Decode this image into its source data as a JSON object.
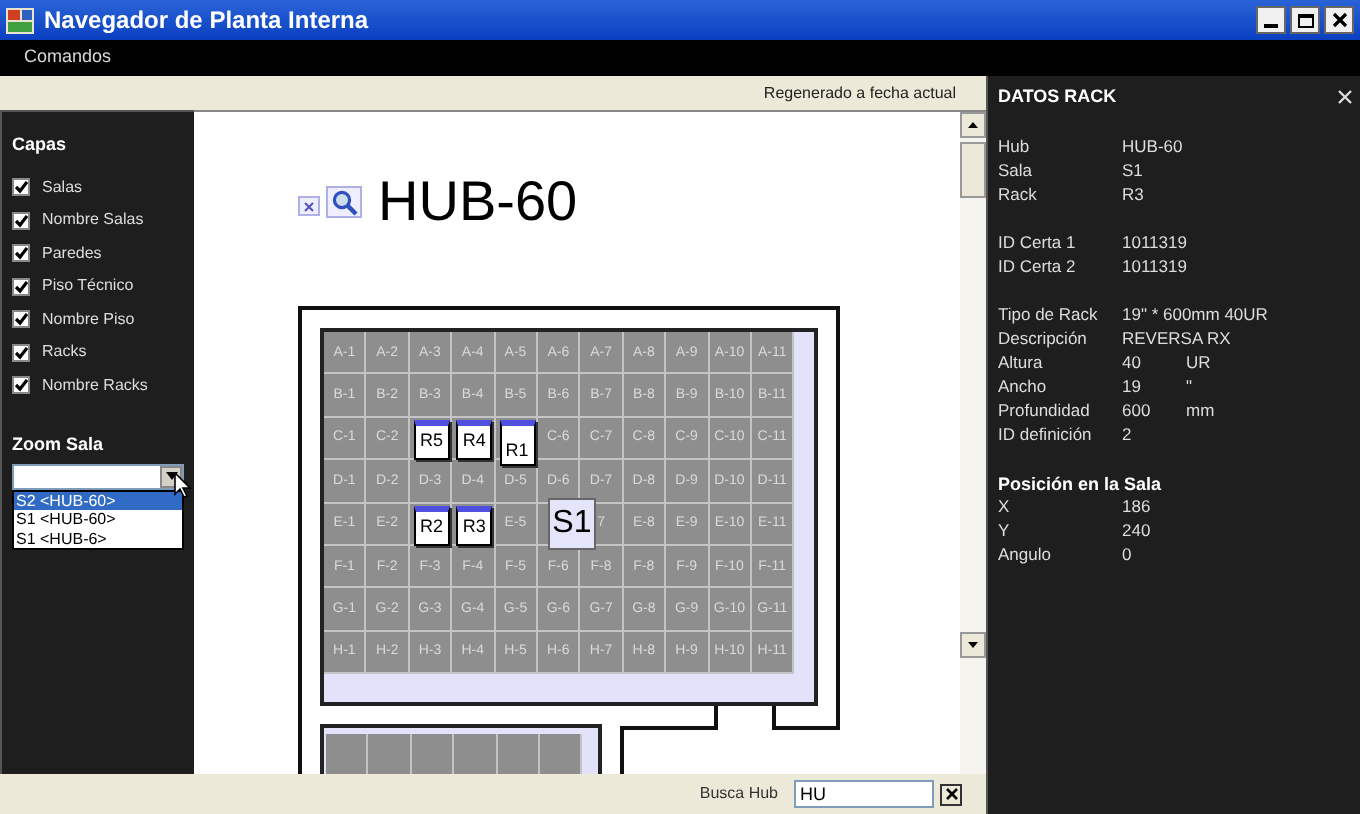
{
  "window": {
    "title": "Navegador de Planta Interna"
  },
  "menu": [
    "Comandos"
  ],
  "toolbar": {
    "status": "Regenerado a fecha actual"
  },
  "layers": {
    "title": "Capas",
    "items": [
      {
        "label": "Salas",
        "checked": true
      },
      {
        "label": "Nombre Salas",
        "checked": true
      },
      {
        "label": "Paredes",
        "checked": true
      },
      {
        "label": "Piso Técnico",
        "checked": true
      },
      {
        "label": "Nombre Piso",
        "checked": true
      },
      {
        "label": "Racks",
        "checked": true
      },
      {
        "label": "Nombre Racks",
        "checked": true
      }
    ]
  },
  "zoom_sala": {
    "title": "Zoom Sala",
    "options": [
      {
        "label": "S2 <HUB-60>",
        "selected": true
      },
      {
        "label": "S1 <HUB-60>",
        "selected": false
      },
      {
        "label": "S1 <HUB-6>",
        "selected": false
      }
    ]
  },
  "canvas": {
    "hub": "HUB-60",
    "grid": [
      [
        "A-1",
        "A-2",
        "A-3",
        "A-4",
        "A-5",
        "A-6",
        "A-7",
        "A-8",
        "A-9",
        "A-10",
        "A-11"
      ],
      [
        "B-1",
        "B-2",
        "B-3",
        "B-4",
        "B-5",
        "B-6",
        "B-7",
        "B-8",
        "B-9",
        "B-10",
        "B-11"
      ],
      [
        "C-1",
        "C-2",
        {
          "rack": "R5",
          "tall": false
        },
        {
          "rack": "R4",
          "tall": false
        },
        {
          "rack": "R1",
          "tall": true
        },
        "C-6",
        "C-7",
        "C-8",
        "C-9",
        "C-10",
        "C-11"
      ],
      [
        "D-1",
        "D-2",
        "D-3",
        "D-4",
        "D-5",
        "D-6",
        "D-7",
        "D-8",
        "D-9",
        "D-10",
        "D-11"
      ],
      [
        "E-1",
        "E-2",
        {
          "rack": "R2",
          "tall": false
        },
        {
          "rack": "R3",
          "tall": false
        },
        "E-5",
        {
          "room": "S1"
        },
        "7",
        "E-8",
        "E-9",
        "E-10",
        "E-11"
      ],
      [
        "F-1",
        "F-2",
        "F-3",
        "F-4",
        "F-5",
        "F-6",
        "F-8",
        "F-8",
        "F-9",
        "F-10",
        "F-11"
      ],
      [
        "G-1",
        "G-2",
        "G-3",
        "G-4",
        "G-5",
        "G-6",
        "G-7",
        "G-8",
        "G-9",
        "G-10",
        "G-11"
      ],
      [
        "H-1",
        "H-2",
        "H-3",
        "H-4",
        "H-5",
        "H-6",
        "H-7",
        "H-8",
        "H-9",
        "H-10",
        "H-11"
      ]
    ]
  },
  "search": {
    "label": "Busca Hub",
    "value": "HU"
  },
  "rack_panel": {
    "title": "DATOS RACK",
    "sections": [
      {
        "rows": [
          {
            "label": "Hub",
            "value": "HUB-60"
          },
          {
            "label": "Sala",
            "value": "S1"
          },
          {
            "label": "Rack",
            "value": "R3"
          }
        ]
      },
      {
        "rows": [
          {
            "label": "ID Certa 1",
            "value": "1011319"
          },
          {
            "label": "ID Certa 2",
            "value": "1011319"
          }
        ]
      },
      {
        "rows": [
          {
            "label": "Tipo de Rack",
            "value": "19\" * 600mm 40UR"
          },
          {
            "label": "Descripción",
            "value": "REVERSA RX"
          },
          {
            "label": "Altura",
            "value": "40",
            "unit": "UR"
          },
          {
            "label": "Ancho",
            "value": "19",
            "unit": "\""
          },
          {
            "label": "Profundidad",
            "value": "600",
            "unit": "mm"
          },
          {
            "label": "ID definición",
            "value": "2"
          }
        ]
      },
      {
        "title": "Posición en la Sala",
        "rows": [
          {
            "label": "X",
            "value": "186"
          },
          {
            "label": "Y",
            "value": "240"
          },
          {
            "label": "Angulo",
            "value": "0"
          }
        ]
      }
    ]
  }
}
